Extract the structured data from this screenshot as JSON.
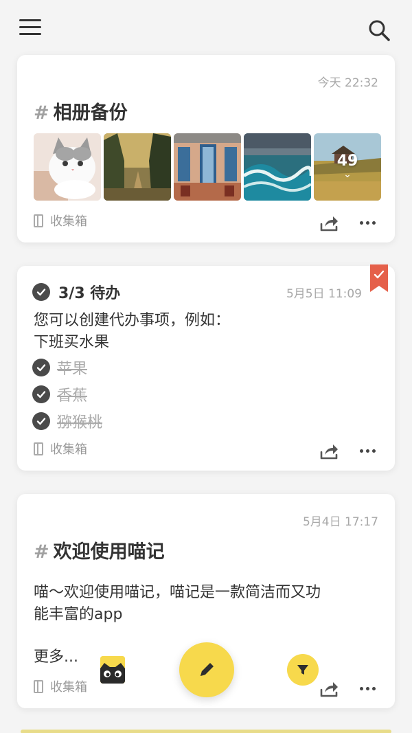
{
  "topbar": {
    "menu_icon": "hamburger-menu-icon",
    "search_icon": "search-icon"
  },
  "card1": {
    "time": "今天 22:32",
    "hash": "#",
    "title": "相册备份",
    "photo_count": "49",
    "notebook": "收集箱"
  },
  "card2": {
    "header": "3/3 待办",
    "time": "5月5日 11:09",
    "text_line1": "您可以创建代办事项，例如：",
    "text_line2": "下班买水果",
    "items": [
      "苹果",
      "香蕉",
      "猕猴桃"
    ],
    "notebook": "收集箱",
    "bookmark_color": "#e5604a"
  },
  "card3": {
    "time": "5月4日 17:17",
    "hash": "#",
    "title": "欢迎使用喵记",
    "body_line1": "喵～欢迎使用喵记，喵记是一款简洁而又功",
    "body_line2": "能丰富的app",
    "more": "更多...",
    "notebook": "收集箱"
  },
  "colors": {
    "accent": "#f7d94c",
    "text": "#333333",
    "muted": "#a8a8a8"
  }
}
